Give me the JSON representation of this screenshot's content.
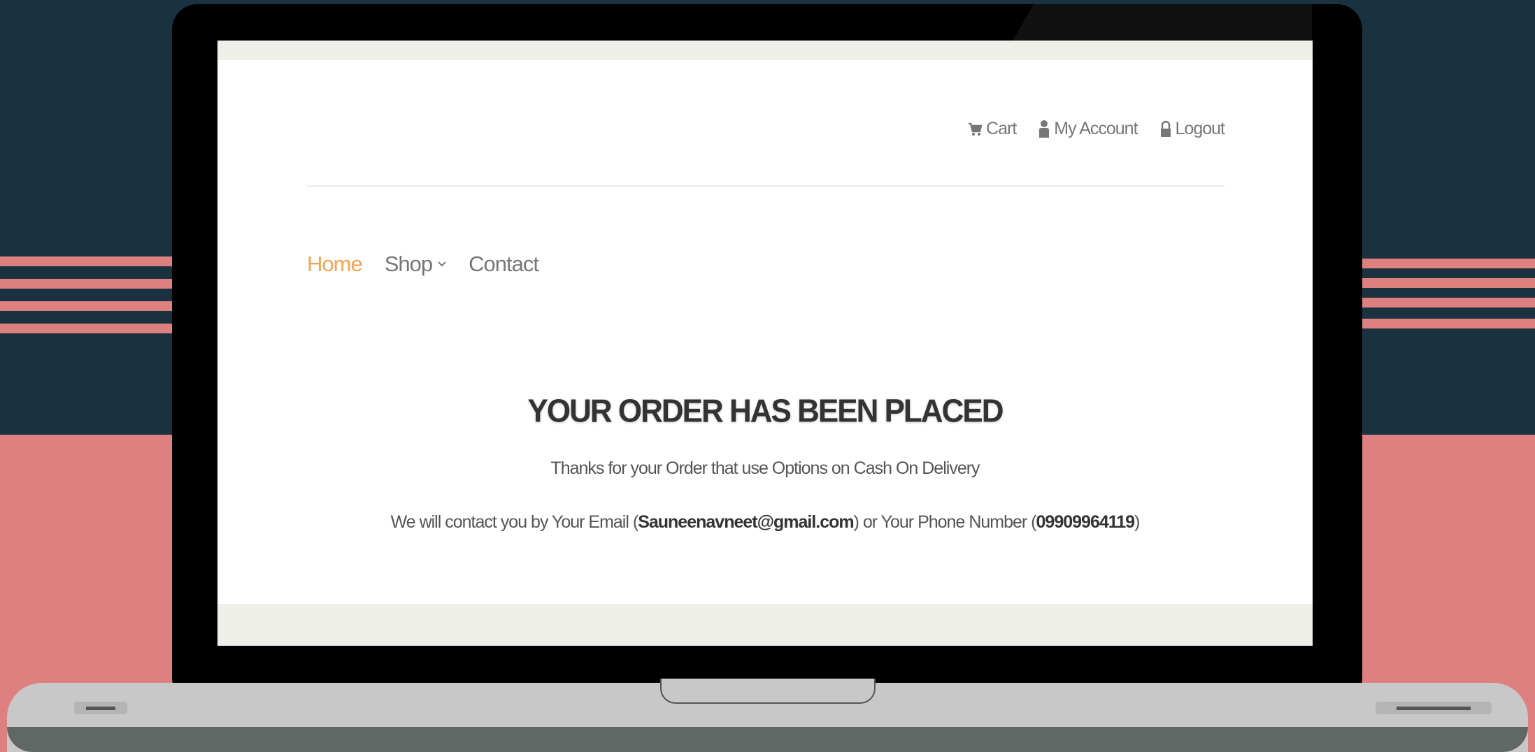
{
  "colors": {
    "background_dark": "#1a3240",
    "background_pink": "#df8080",
    "nav_active": "#f7a34f",
    "text_muted": "#777777"
  },
  "header": {
    "links": [
      {
        "icon": "cart-icon",
        "label": "Cart"
      },
      {
        "icon": "user-icon",
        "label": "My Account"
      },
      {
        "icon": "lock-icon",
        "label": "Logout"
      }
    ]
  },
  "nav": {
    "items": [
      {
        "label": "Home",
        "active": true
      },
      {
        "label": "Shop",
        "icon": "chevron-down-icon"
      },
      {
        "label": "Contact"
      }
    ]
  },
  "order": {
    "title": "YOUR ORDER HAS BEEN PLACED",
    "thanks": "Thanks for your Order that use Options on Cash On Delivery",
    "contact_prefix": "We will contact you by Your Email (",
    "email": "Sauneenavneet@gmail.com",
    "contact_middle": ") or Your Phone Number (",
    "phone": "09909964119",
    "contact_suffix": ")"
  }
}
